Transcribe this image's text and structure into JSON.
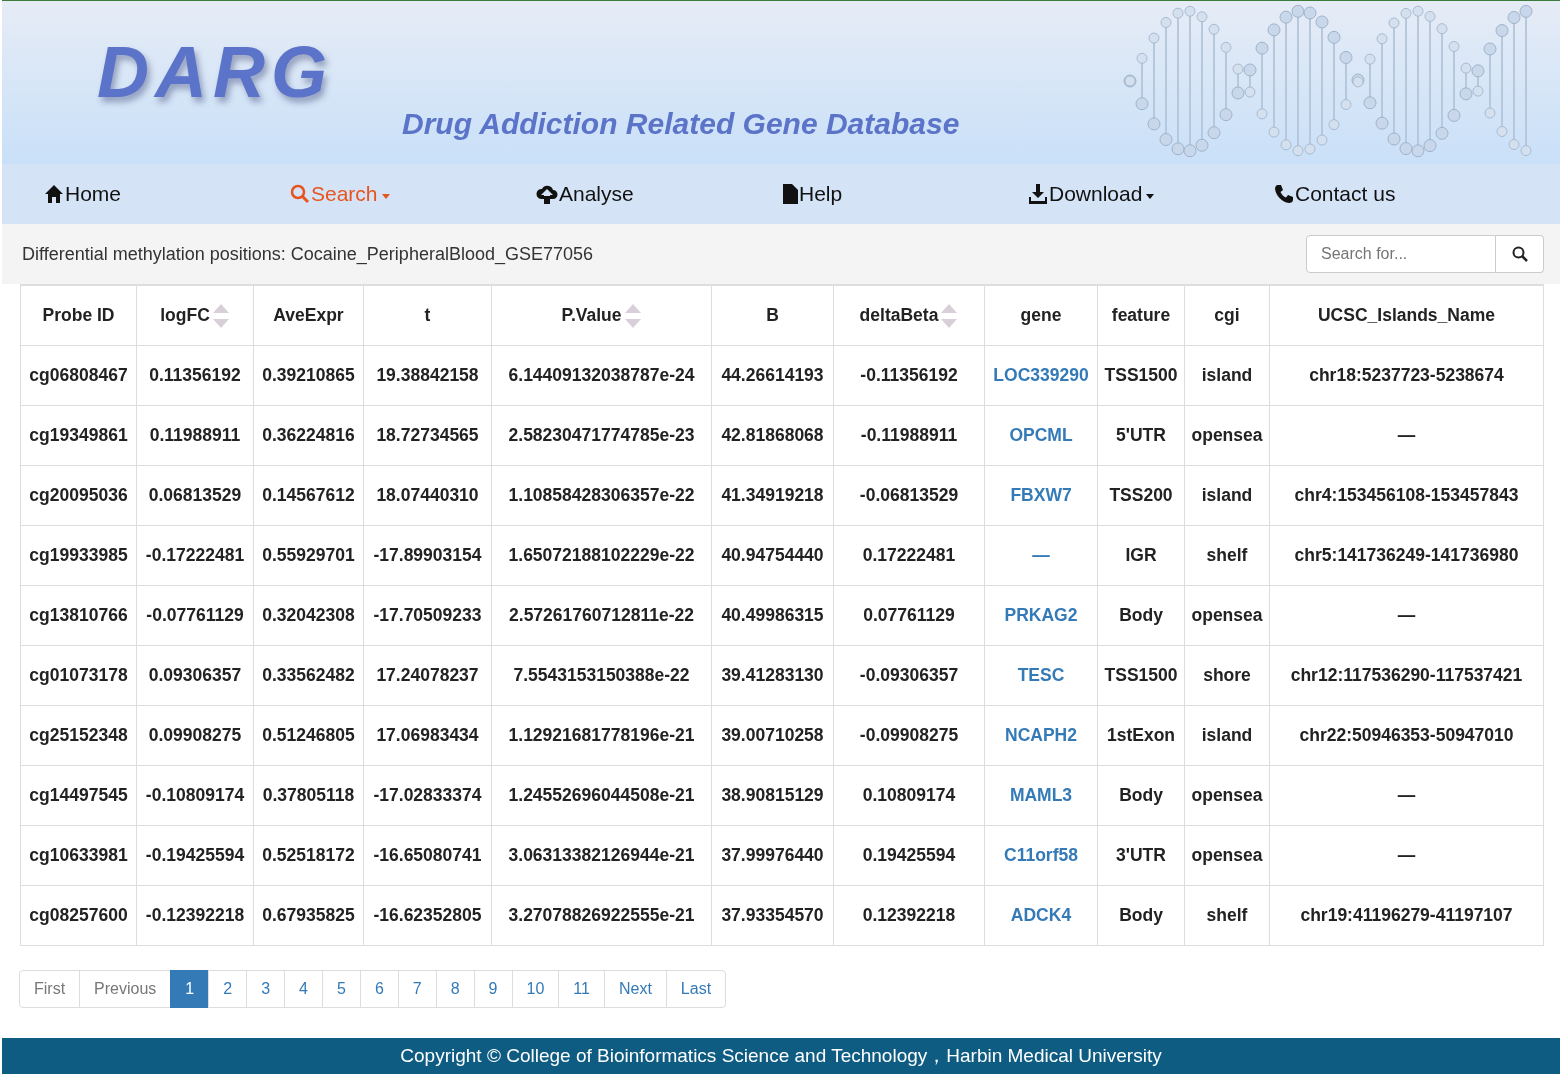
{
  "header": {
    "logo": "DARG",
    "subtitle": "Drug Addiction Related Gene Database"
  },
  "nav": [
    {
      "label": "Home",
      "kind": "home",
      "dropdown": false,
      "selected": false
    },
    {
      "label": "Search",
      "kind": "search",
      "dropdown": true,
      "selected": true
    },
    {
      "label": "Analyse",
      "kind": "cloud",
      "dropdown": false,
      "selected": false
    },
    {
      "label": "Help",
      "kind": "file",
      "dropdown": false,
      "selected": false
    },
    {
      "label": "Download",
      "kind": "download",
      "dropdown": true,
      "selected": false
    },
    {
      "label": "Contact us",
      "kind": "phone",
      "dropdown": false,
      "selected": false
    }
  ],
  "page_title": "Differential methylation positions: Cocaine_PeripheralBlood_GSE77056",
  "search": {
    "placeholder": "Search for..."
  },
  "table": {
    "columns": [
      {
        "label": "Probe ID",
        "sortable": false,
        "kind": "text"
      },
      {
        "label": "logFC",
        "sortable": true,
        "kind": "text"
      },
      {
        "label": "AveExpr",
        "sortable": false,
        "kind": "text"
      },
      {
        "label": "t",
        "sortable": false,
        "kind": "text"
      },
      {
        "label": "P.Value",
        "sortable": true,
        "kind": "text"
      },
      {
        "label": "B",
        "sortable": false,
        "kind": "text"
      },
      {
        "label": "deltaBeta",
        "sortable": true,
        "kind": "text"
      },
      {
        "label": "gene",
        "sortable": false,
        "kind": "link"
      },
      {
        "label": "feature",
        "sortable": false,
        "kind": "text"
      },
      {
        "label": "cgi",
        "sortable": false,
        "kind": "text"
      },
      {
        "label": "UCSC_Islands_Name",
        "sortable": false,
        "kind": "text"
      }
    ],
    "rows": [
      [
        "cg06808467",
        "0.11356192",
        "0.39210865",
        "19.38842158",
        "6.14409132038787e-24",
        "44.26614193",
        "-0.11356192",
        "LOC339290",
        "TSS1500",
        "island",
        "chr18:5237723-5238674"
      ],
      [
        "cg19349861",
        "0.11988911",
        "0.36224816",
        "18.72734565",
        "2.58230471774785e-23",
        "42.81868068",
        "-0.11988911",
        "OPCML",
        "5'UTR",
        "opensea",
        "—"
      ],
      [
        "cg20095036",
        "0.06813529",
        "0.14567612",
        "18.07440310",
        "1.10858428306357e-22",
        "41.34919218",
        "-0.06813529",
        "FBXW7",
        "TSS200",
        "island",
        "chr4:153456108-153457843"
      ],
      [
        "cg19933985",
        "-0.17222481",
        "0.55929701",
        "-17.89903154",
        "1.65072188102229e-22",
        "40.94754440",
        "0.17222481",
        "—",
        "IGR",
        "shelf",
        "chr5:141736249-141736980"
      ],
      [
        "cg13810766",
        "-0.07761129",
        "0.32042308",
        "-17.70509233",
        "2.57261760712811e-22",
        "40.49986315",
        "0.07761129",
        "PRKAG2",
        "Body",
        "opensea",
        "—"
      ],
      [
        "cg01073178",
        "0.09306357",
        "0.33562482",
        "17.24078237",
        "7.5543153150388e-22",
        "39.41283130",
        "-0.09306357",
        "TESC",
        "TSS1500",
        "shore",
        "chr12:117536290-117537421"
      ],
      [
        "cg25152348",
        "0.09908275",
        "0.51246805",
        "17.06983434",
        "1.12921681778196e-21",
        "39.00710258",
        "-0.09908275",
        "NCAPH2",
        "1stExon",
        "island",
        "chr22:50946353-50947010"
      ],
      [
        "cg14497545",
        "-0.10809174",
        "0.37805118",
        "-17.02833374",
        "1.24552696044508e-21",
        "38.90815129",
        "0.10809174",
        "MAML3",
        "Body",
        "opensea",
        "—"
      ],
      [
        "cg10633981",
        "-0.19425594",
        "0.52518172",
        "-16.65080741",
        "3.06313382126944e-21",
        "37.99976440",
        "0.19425594",
        "C11orf58",
        "3'UTR",
        "opensea",
        "—"
      ],
      [
        "cg08257600",
        "-0.12392218",
        "0.67935825",
        "-16.62352805",
        "3.27078826922555e-21",
        "37.93354570",
        "0.12392218",
        "ADCK4",
        "Body",
        "shelf",
        "chr19:41196279-41197107"
      ]
    ]
  },
  "pagination": [
    {
      "label": "First",
      "selected": false,
      "disabled": true
    },
    {
      "label": "Previous",
      "selected": false,
      "disabled": true
    },
    {
      "label": "1",
      "selected": true,
      "disabled": false
    },
    {
      "label": "2",
      "selected": false,
      "disabled": false
    },
    {
      "label": "3",
      "selected": false,
      "disabled": false
    },
    {
      "label": "4",
      "selected": false,
      "disabled": false
    },
    {
      "label": "5",
      "selected": false,
      "disabled": false
    },
    {
      "label": "6",
      "selected": false,
      "disabled": false
    },
    {
      "label": "7",
      "selected": false,
      "disabled": false
    },
    {
      "label": "8",
      "selected": false,
      "disabled": false
    },
    {
      "label": "9",
      "selected": false,
      "disabled": false
    },
    {
      "label": "10",
      "selected": false,
      "disabled": false
    },
    {
      "label": "11",
      "selected": false,
      "disabled": false
    },
    {
      "label": "Next",
      "selected": false,
      "disabled": false
    },
    {
      "label": "Last",
      "selected": false,
      "disabled": false
    }
  ],
  "footer": "Copyright © College of Bioinformatics Science and Technology，Harbin Medical University"
}
